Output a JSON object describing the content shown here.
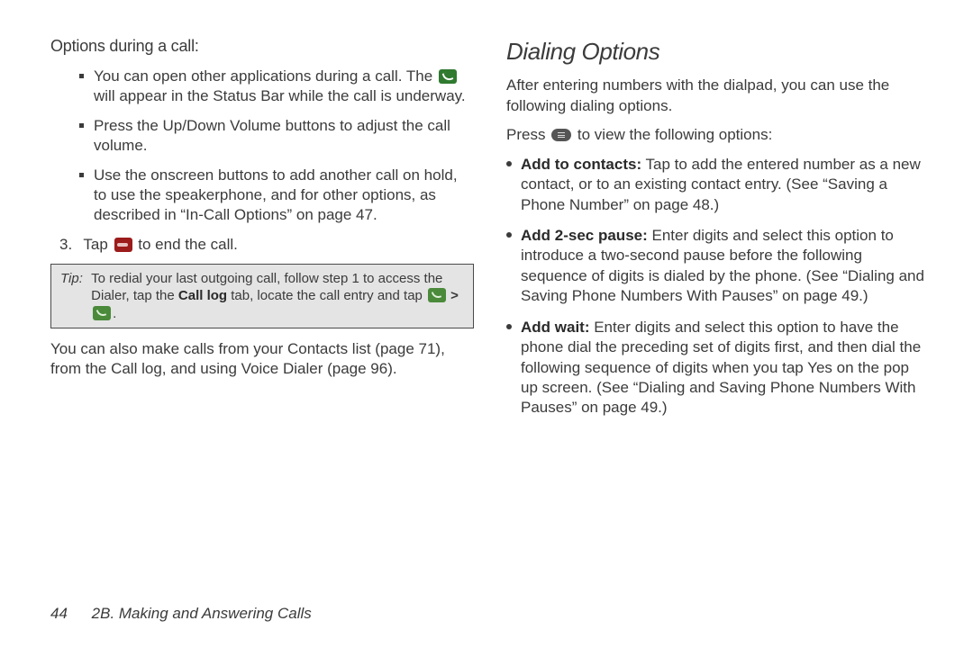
{
  "left": {
    "heading": "Options during a call:",
    "bullets": [
      {
        "before": "You can open other applications during a call. The ",
        "icon": "call-green",
        "after": " will appear in the Status Bar while the call is underway."
      },
      {
        "text": "Press the Up/Down Volume buttons to adjust the call volume."
      },
      {
        "text": "Use the onscreen buttons to add another call on hold, to use the speakerphone, and for other options, as described in “In-Call Options” on page 47."
      }
    ],
    "step3_num": "3.",
    "step3_before": "Tap ",
    "step3_icon": "end-red",
    "step3_after": " to end the call.",
    "tip_label": "Tip:",
    "tip_text_1": "To redial your last outgoing call, follow step 1 to access the Dialer, tap the ",
    "tip_bold": "Call log",
    "tip_text_2": " tab, locate the call entry and tap ",
    "tip_gt": ">",
    "tip_period": ".",
    "closing": "You can also make calls from your Contacts list (page 71), from the Call log, and using Voice Dialer (page 96)."
  },
  "right": {
    "heading": "Dialing Options",
    "intro": "After entering numbers with the dialpad, you can use the following dialing options.",
    "press_before": "Press ",
    "press_icon": "menu",
    "press_after": " to view the following options:",
    "items": [
      {
        "bold": "Add to contacts:",
        "text": " Tap to add the entered number as a new contact, or to an existing contact entry. (See “Saving a Phone Number” on page 48.)"
      },
      {
        "bold": "Add 2-sec pause:",
        "text": " Enter digits and select this option to introduce a two-second pause before the following sequence of digits is dialed by the phone. (See “Dialing and Saving Phone Numbers With Pauses” on page 49.)"
      },
      {
        "bold": "Add wait:",
        "text": " Enter digits and select this option to have the phone dial the preceding set of digits first, and then dial the following sequence of digits when you tap Yes on the pop up screen. (See “Dialing and Saving Phone Numbers With Pauses” on page 49.)"
      }
    ]
  },
  "footer": {
    "page": "44",
    "section": "2B. Making and Answering Calls"
  }
}
